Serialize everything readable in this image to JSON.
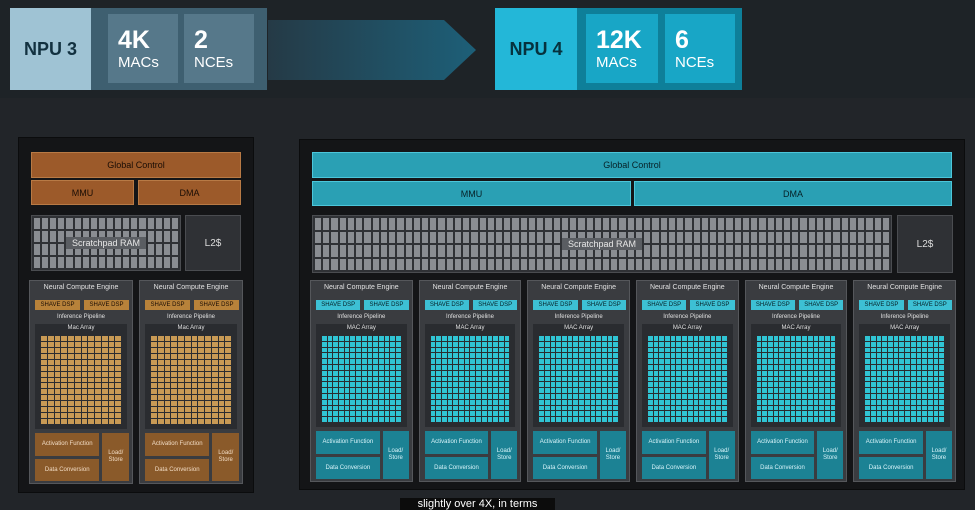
{
  "npu3": {
    "label": "NPU 3",
    "macs_value": "4K",
    "macs_unit": "MACs",
    "nces_value": "2",
    "nces_unit": "NCEs",
    "global_control": "Global Control",
    "mmu": "MMU",
    "dma": "DMA",
    "scratchpad": "Scratchpad RAM",
    "l2": "L2$",
    "nce": {
      "title": "Neural Compute Engine",
      "dsp1": "SHAVE DSP",
      "dsp2": "SHAVE DSP",
      "pipeline": "Inference Pipeline",
      "mac_array": "Mac Array",
      "activation": "Activation Function",
      "load_store": "Load/ Store",
      "data_conversion": "Data Conversion"
    },
    "colors": {
      "accent": "#9c5a2a",
      "mac": "#c89a55"
    }
  },
  "npu4": {
    "label": "NPU 4",
    "macs_value": "12K",
    "macs_unit": "MACs",
    "nces_value": "6",
    "nces_unit": "NCEs",
    "global_control": "Global Control",
    "mmu": "MMU",
    "dma": "DMA",
    "scratchpad": "Scratchpad RAM",
    "l2": "L2$",
    "nce": {
      "title": "Neural Compute Engine",
      "dsp1": "SHAVE DSP",
      "dsp2": "SHAVE DSP",
      "pipeline": "Inference Pipeline",
      "mac_array": "MAC Array",
      "activation": "Activation Function",
      "load_store": "Load/ Store",
      "data_conversion": "Data Conversion"
    },
    "colors": {
      "accent": "#2aa0b4",
      "mac": "#30c4d4"
    }
  },
  "caption": "slightly over 4X, in terms"
}
